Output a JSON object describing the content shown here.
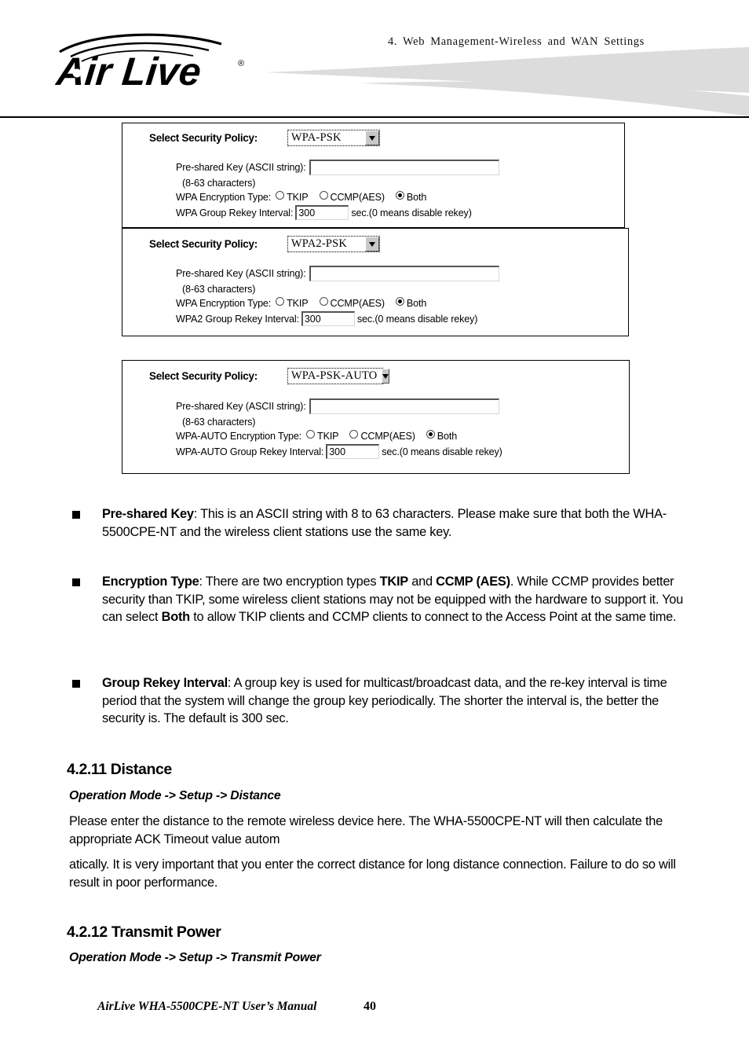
{
  "header": {
    "chapter_title": "4.  Web  Management-Wireless  and  WAN  Settings",
    "logo_text": "Air Live",
    "logo_trademark": "®"
  },
  "panels": [
    {
      "id": "wpa-psk",
      "policy_label": "Select Security Policy:",
      "policy_value": "WPA-PSK",
      "psk_label": "Pre-shared Key (ASCII string):",
      "psk_value": "",
      "hint": "(8-63 characters)",
      "encryption_label": "WPA Encryption Type:",
      "encryption_options": [
        {
          "label": "TKIP",
          "checked": false
        },
        {
          "label": "CCMP(AES)",
          "checked": false
        },
        {
          "label": "Both",
          "checked": true
        }
      ],
      "rekey_label": "WPA Group Rekey Interval:",
      "rekey_value": "300",
      "rekey_suffix": "sec.(0 means disable rekey)"
    },
    {
      "id": "wpa2-psk",
      "policy_label": "Select Security Policy:",
      "policy_value": "WPA2-PSK",
      "psk_label": "Pre-shared Key (ASCII string):",
      "psk_value": "",
      "hint": "(8-63 characters)",
      "encryption_label": "WPA Encryption Type:",
      "encryption_options": [
        {
          "label": "TKIP",
          "checked": false
        },
        {
          "label": "CCMP(AES)",
          "checked": false
        },
        {
          "label": "Both",
          "checked": true
        }
      ],
      "rekey_label": "WPA2 Group Rekey Interval:",
      "rekey_value": "300",
      "rekey_suffix": "sec.(0 means disable rekey)"
    },
    {
      "id": "wpa-psk-auto",
      "policy_label": "Select Security Policy:",
      "policy_value": "WPA-PSK-AUTO",
      "psk_label": "Pre-shared Key (ASCII string):",
      "psk_value": "",
      "hint": "(8-63 characters)",
      "encryption_label": "WPA-AUTO Encryption Type:",
      "encryption_options": [
        {
          "label": "TKIP",
          "checked": false
        },
        {
          "label": "CCMP(AES)",
          "checked": false
        },
        {
          "label": "Both",
          "checked": true
        }
      ],
      "rekey_label": "WPA-AUTO Group Rekey Interval:",
      "rekey_value": "300",
      "rekey_suffix": "sec.(0 means disable rekey)"
    }
  ],
  "bullets": {
    "preshared_key": {
      "term": "Pre-shared Key",
      "body": ": This is an ASCII string with 8 to 63 characters. Please make sure that both the WHA-5500CPE-NT and the wireless client stations use the same key."
    },
    "encryption_type": {
      "term": "Encryption Type",
      "part1": ": There are two encryption types ",
      "bold1": "TKIP",
      "part2": " and ",
      "bold2": "CCMP (AES)",
      "part3": ". While CCMP provides better security than TKIP, some wireless client stations may not be equipped with the hardware to support it. You can select ",
      "bold3": "Both",
      "part4": " to allow TKIP clients and CCMP clients to connect to the Access Point at the same time."
    },
    "group_rekey": {
      "term": "Group Rekey Interval",
      "body": ": A group key is used for multicast/broadcast data, and the re-key interval is time period that the system will change the group key periodically. The shorter the interval is, the better the security is. The default is 300 sec."
    }
  },
  "sections": {
    "distance": {
      "heading": "4.2.11 Distance",
      "path": "Operation Mode -> Setup -> Distance",
      "para1": "Please enter the distance to the remote wireless device here.    The WHA-5500CPE-NT will then calculate the appropriate ACK Timeout value autom",
      "para2": "atically.    It is very important that you enter the correct distance for long distance connection.    Failure to do so will result in poor performance."
    },
    "transmit_power": {
      "heading": "4.2.12 Transmit Power",
      "path": "Operation Mode -> Setup -> Transmit Power"
    }
  },
  "footer": {
    "manual_title": "AirLive WHA-5500CPE-NT User’s Manual",
    "page_number": "40"
  }
}
